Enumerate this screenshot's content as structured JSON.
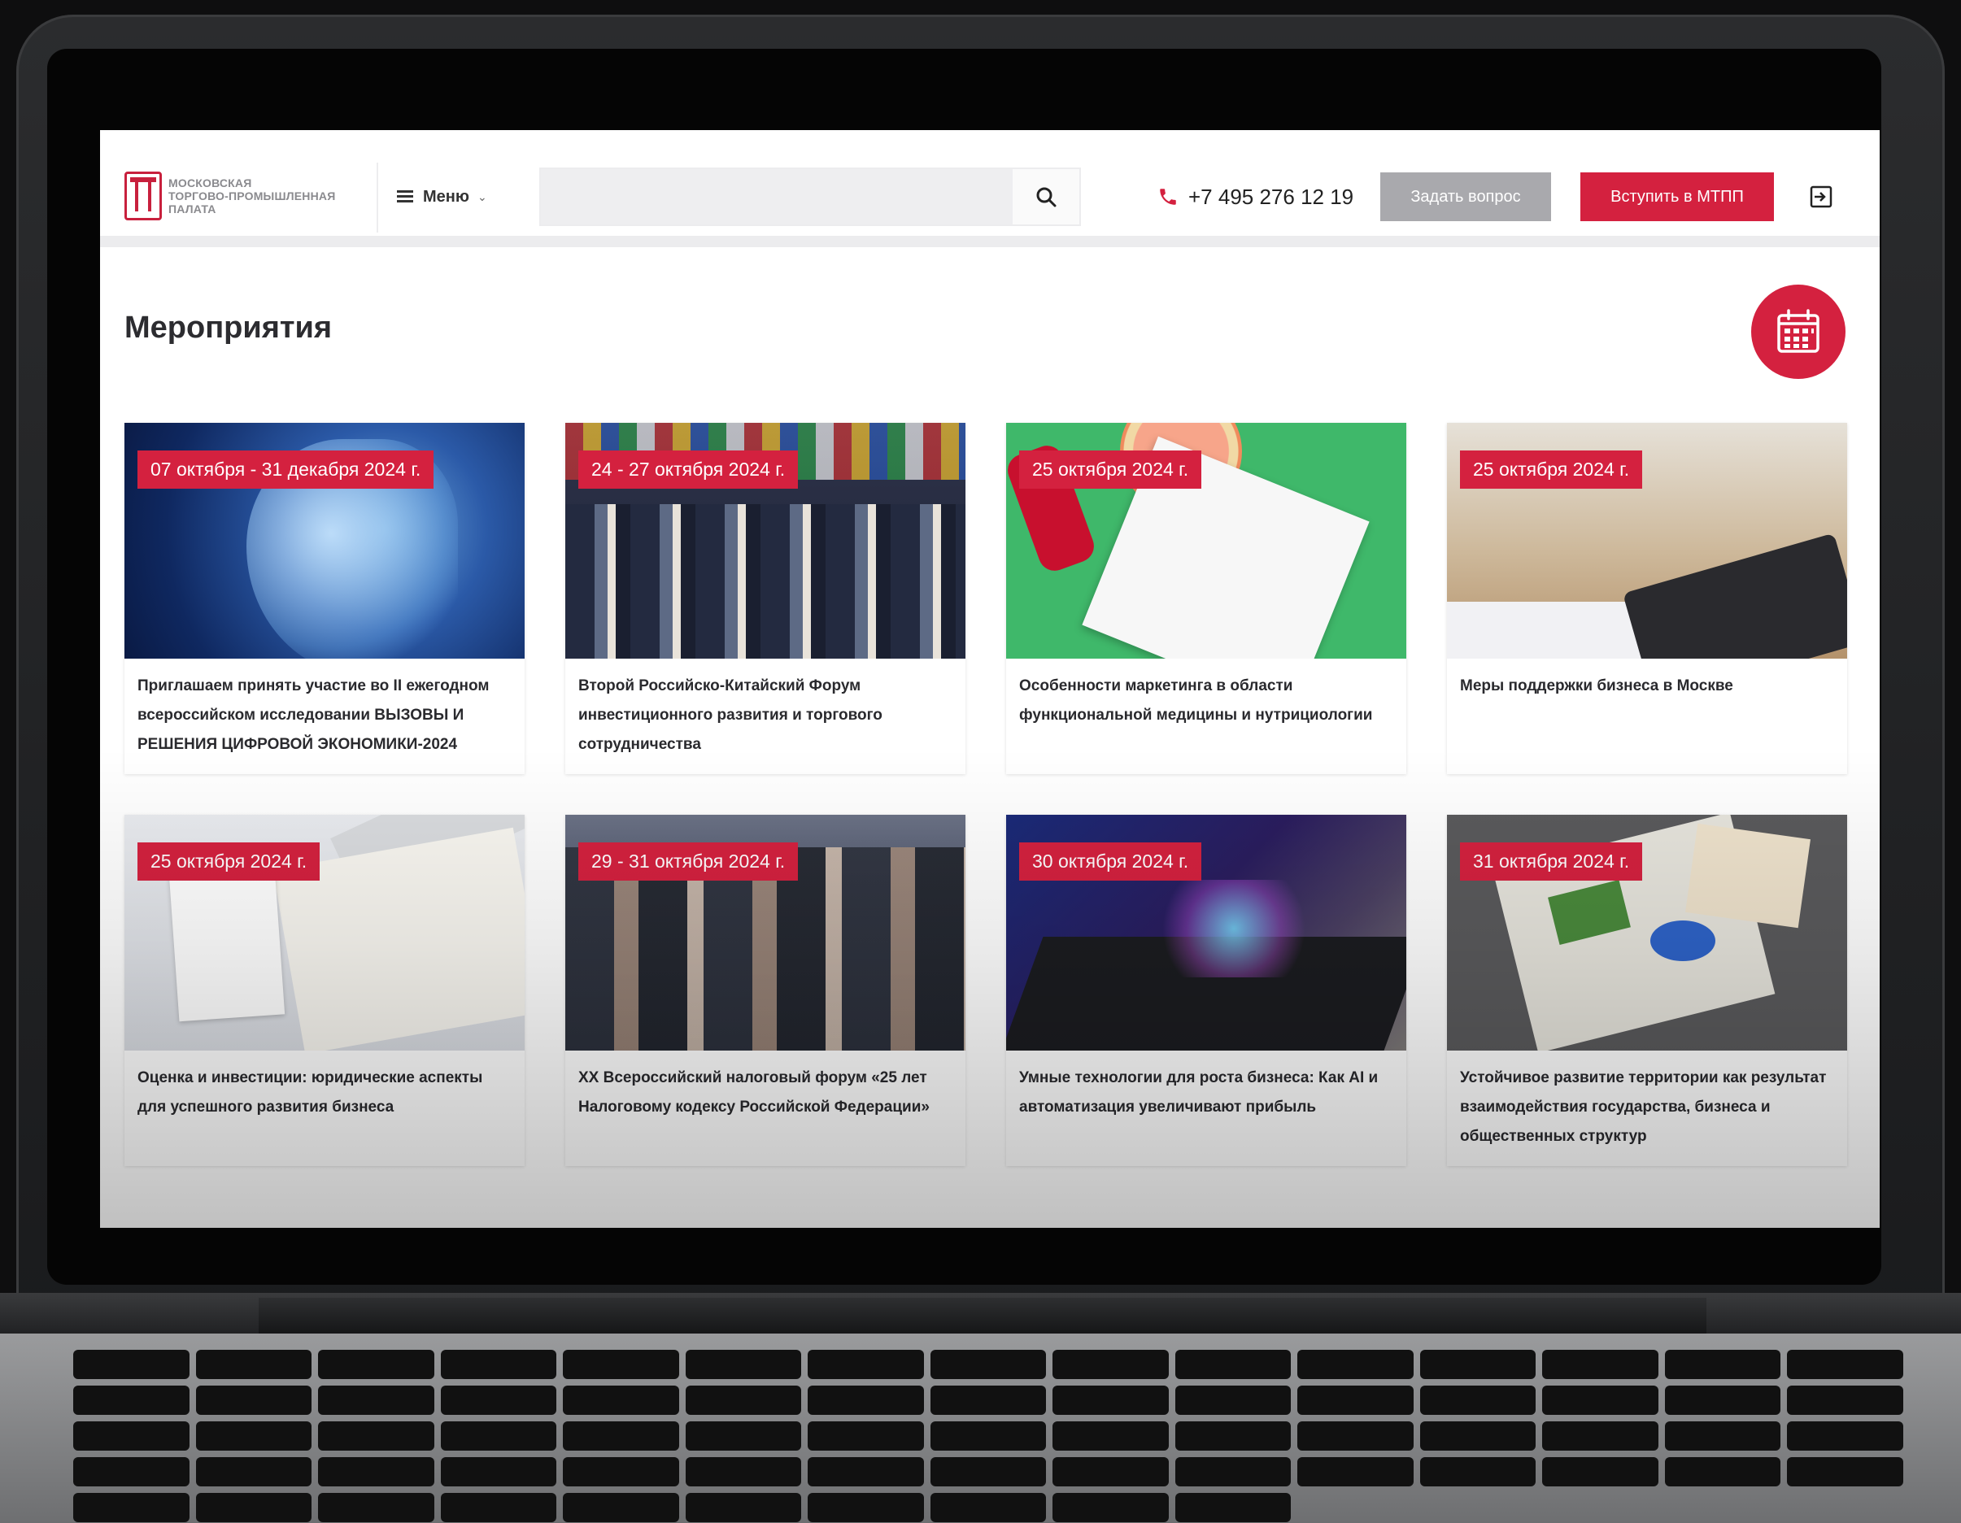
{
  "header": {
    "logo_lines": [
      "МОСКОВСКАЯ",
      "ТОРГОВО-ПРОМЫШЛЕННАЯ",
      "ПАЛАТА"
    ],
    "menu_label": "Меню",
    "search_placeholder": "",
    "phone": "+7 495 276 12 19",
    "ask_label": "Задать вопрос",
    "join_label": "Вступить в МТПП"
  },
  "page": {
    "title": "Мероприятия"
  },
  "events": [
    {
      "date": "07 октября - 31 декабря 2024 г.",
      "title": "Приглашаем принять участие во II ежегодном всероссийском исследовании ВЫЗОВЫ И РЕШЕНИЯ ЦИФРОВОЙ ЭКОНОМИКИ-2024"
    },
    {
      "date": "24 - 27 октября 2024 г.",
      "title": "Второй Российско-Китайский Форум инвестиционного развития и торгового сотрудничества"
    },
    {
      "date": "25 октября 2024 г.",
      "title": "Особенности маркетинга в области функциональной медицины и нутрициологии"
    },
    {
      "date": "25 октября 2024 г.",
      "title": "Меры поддержки бизнеса в Москве"
    },
    {
      "date": "25 октября 2024 г.",
      "title": "Оценка и инвестиции: юридические аспекты для успешного развития бизнеса"
    },
    {
      "date": "29 - 31 октября 2024 г.",
      "title": "XX Всероссийский налоговый форум «25 лет Налоговому кодексу Российской Федерации»"
    },
    {
      "date": "30 октября 2024 г.",
      "title": "Умные технологии для роста бизнеса: Как AI и автоматизация увеличивают прибыль"
    },
    {
      "date": "31 октября 2024 г.",
      "title": "Устойчивое развитие территории как результат взаимодействия государства, бизнеса и общественных структур"
    }
  ],
  "colors": {
    "accent": "#d4213f",
    "ask_button": "#a9a9ad",
    "title_text": "#2c2c30"
  },
  "icons": {
    "menu": "hamburger-icon",
    "search": "search-icon",
    "phone": "phone-icon",
    "login": "login-icon",
    "calendar": "calendar-icon"
  }
}
